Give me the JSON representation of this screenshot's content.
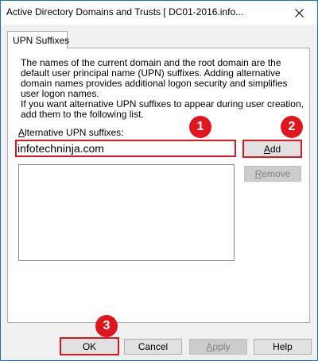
{
  "window": {
    "title": "Active Directory Domains and Trusts [ DC01-2016.info..."
  },
  "tabs": [
    {
      "label": "UPN Suffixes",
      "active": true
    }
  ],
  "panel": {
    "description_1": "The names of the current domain and the root domain are the default user principal name (UPN) suffixes. Adding alternative domain names provides additional logon security and simplifies user logon names.",
    "description_2": "If you want alternative UPN suffixes to appear during user creation, add them to the following list.",
    "field_label_prefix": "A",
    "field_label_rest": "lternative UPN suffixes:",
    "suffix_input_value": "infotechninja.com",
    "suffix_list_items": [],
    "add_label_prefix": "A",
    "add_label_rest": "dd",
    "remove_label_prefix": "R",
    "remove_label_rest": "emove"
  },
  "footer": {
    "ok_label": "OK",
    "cancel_label": "Cancel",
    "apply_label_prefix": "A",
    "apply_label_rest": "pply",
    "help_label": "Help"
  },
  "annotations": {
    "marker_1": "1",
    "marker_2": "2",
    "marker_3": "3",
    "highlight_color": "#e0161e"
  },
  "colors": {
    "window_border": "#1a6fc9",
    "button_face": "#e1e1e1",
    "disabled_text": "#838383"
  },
  "icons": {
    "close": "close-icon"
  }
}
